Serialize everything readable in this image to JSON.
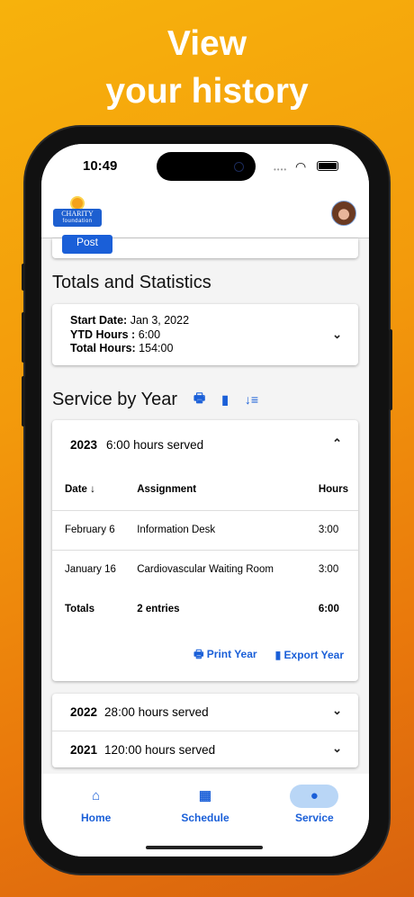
{
  "headline": {
    "line1": "View",
    "line2": "your history"
  },
  "status": {
    "time": "10:49"
  },
  "appbar": {
    "logo_text": "CHARITY",
    "logo_sub": "foundation"
  },
  "post_label": "Post",
  "totals": {
    "title": "Totals and Statistics",
    "start_label": "Start Date:",
    "start_value": "Jan 3, 2022",
    "ytd_label": "YTD Hours :",
    "ytd_value": "6:00",
    "total_label": "Total Hours:",
    "total_value": "154:00"
  },
  "service": {
    "title": "Service by Year",
    "expanded": {
      "year": "2023",
      "summary": "6:00 hours served",
      "columns": [
        "Date ↓",
        "Assignment",
        "Hours"
      ],
      "rows": [
        [
          "February 6",
          "Information Desk",
          "3:00"
        ],
        [
          "January 16",
          "Cardiovascular Waiting Room",
          "3:00"
        ]
      ],
      "totals": [
        "Totals",
        "2 entries",
        "6:00"
      ],
      "print_label": "Print Year",
      "export_label": "Export Year"
    },
    "years": [
      {
        "year": "2022",
        "summary": "28:00 hours served"
      },
      {
        "year": "2021",
        "summary": "120:00 hours served"
      }
    ]
  },
  "nav": [
    {
      "label": "Home",
      "icon": "home-icon"
    },
    {
      "label": "Schedule",
      "icon": "calendar-icon"
    },
    {
      "label": "Service",
      "icon": "clock-icon",
      "active": true
    }
  ]
}
